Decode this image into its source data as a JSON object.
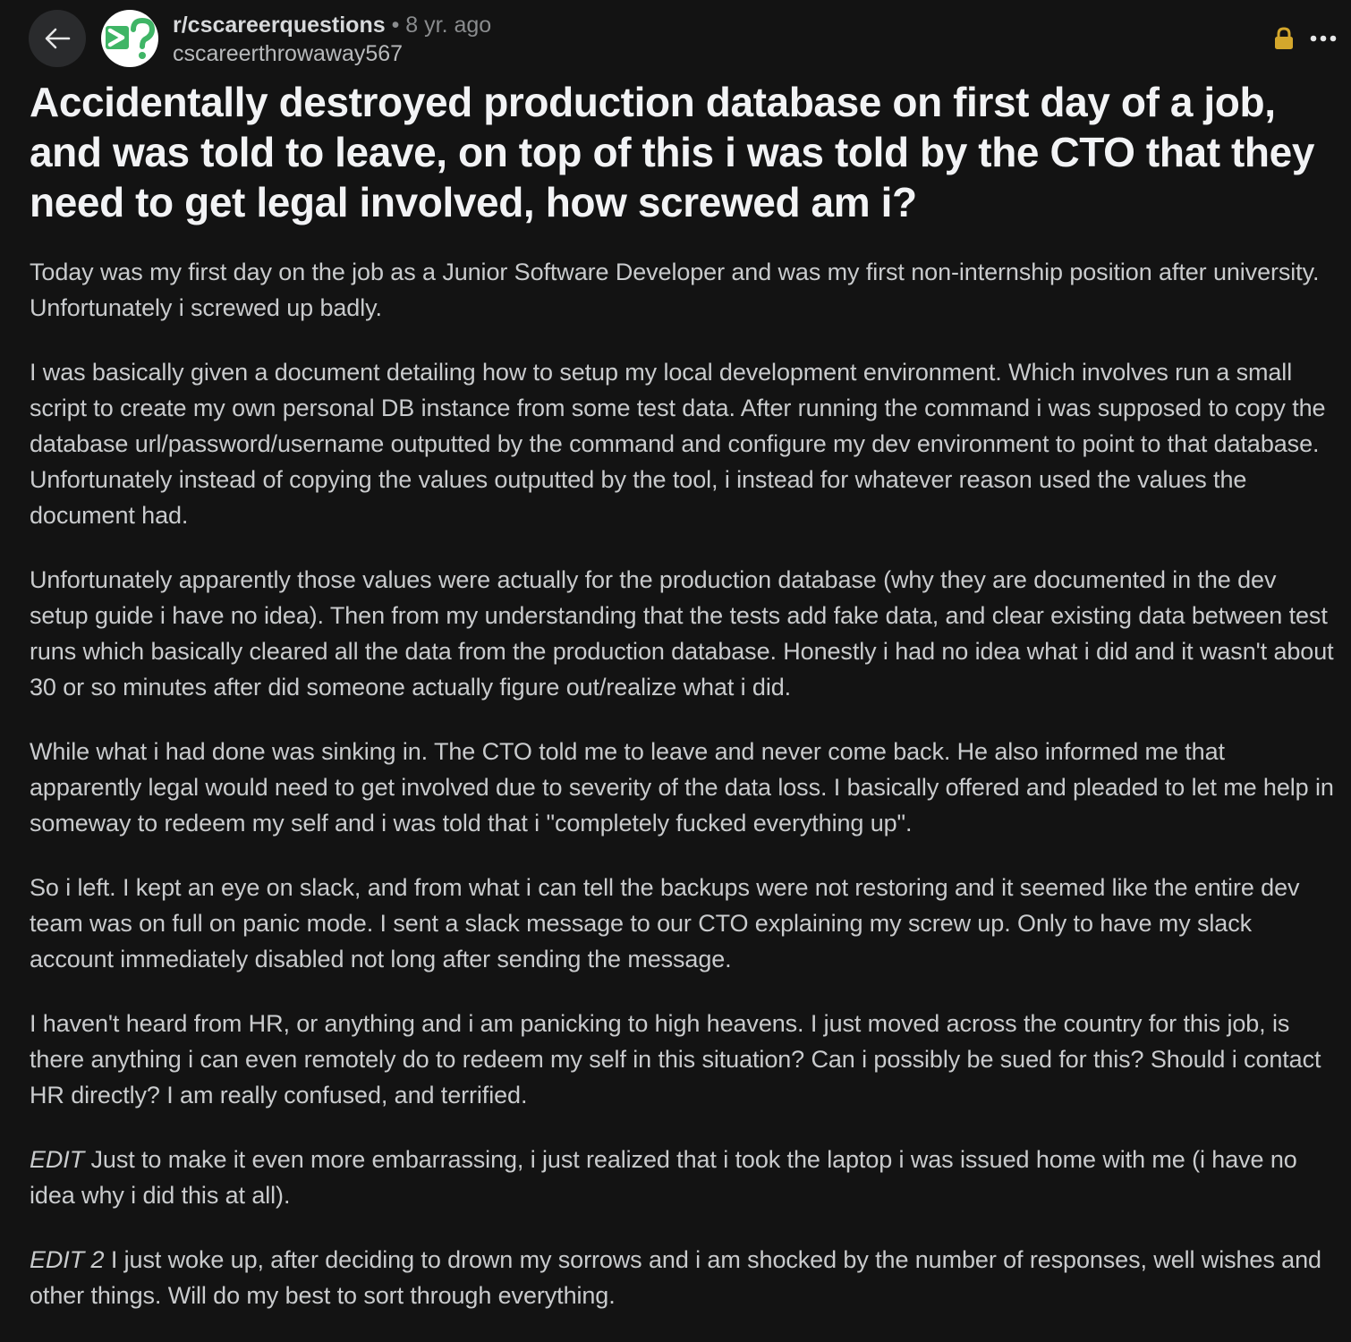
{
  "header": {
    "back_icon": "arrow-left-icon",
    "avatar_text": ">?",
    "avatar_colors": {
      "gt": "#3fb566",
      "q": "#3fb566",
      "bg": "#ffffff"
    },
    "subreddit": "r/cscareerquestions",
    "separator": "•",
    "age": "8 yr. ago",
    "username": "cscareerthrowaway567",
    "lock_icon": "lock-icon",
    "more_icon": "more-horizontal-icon"
  },
  "post": {
    "title": "Accidentally destroyed production database on first day of a job, and was told to leave, on top of this i was told by the CTO that they need to get legal involved, how screwed am i?",
    "paragraphs": [
      "Today was my first day on the job as a Junior Software Developer and was my first non-internship position after university. Unfortunately i screwed up badly.",
      "I was basically given a document detailing how to setup my local development environment. Which involves run a small script to create my own personal DB instance from some test data. After running the command i was supposed to copy the database url/password/username outputted by the command and configure my dev environment to point to that database. Unfortunately instead of copying the values outputted by the tool, i instead for whatever reason used the values the document had.",
      "Unfortunately apparently those values were actually for the production database (why they are documented in the dev setup guide i have no idea). Then from my understanding that the tests add fake data, and clear existing data between test runs which basically cleared all the data from the production database. Honestly i had no idea what i did and it wasn't about 30 or so minutes after did someone actually figure out/realize what i did.",
      "While what i had done was sinking in. The CTO told me to leave and never come back. He also informed me that apparently legal would need to get involved due to severity of the data loss. I basically offered and pleaded to let me help in someway to redeem my self and i was told that i \"completely fucked everything up\".",
      "So i left. I kept an eye on slack, and from what i can tell the backups were not restoring and it seemed like the entire dev team was on full on panic mode. I sent a slack message to our CTO explaining my screw up. Only to have my slack account immediately disabled not long after sending the message.",
      "I haven't heard from HR, or anything and i am panicking to high heavens. I just moved across the country for this job, is there anything i can even remotely do to redeem my self in this situation? Can i possibly be sued for this? Should i contact HR directly? I am really confused, and terrified."
    ],
    "edit1_label": "EDIT",
    "edit1_text": " Just to make it even more embarrassing, i just realized that i took the laptop i was issued home with me (i have no idea why i did this at all).",
    "edit2_label": "EDIT 2",
    "edit2_text": " I just woke up, after deciding to drown my sorrows and i am shocked by the number of responses, well wishes and other things. Will do my best to sort through everything."
  },
  "colors": {
    "background": "#131313",
    "title": "#f2f3f5",
    "body_text": "#c9cbcd",
    "muted": "#8a8c8e",
    "lock": "#d4a72c"
  }
}
